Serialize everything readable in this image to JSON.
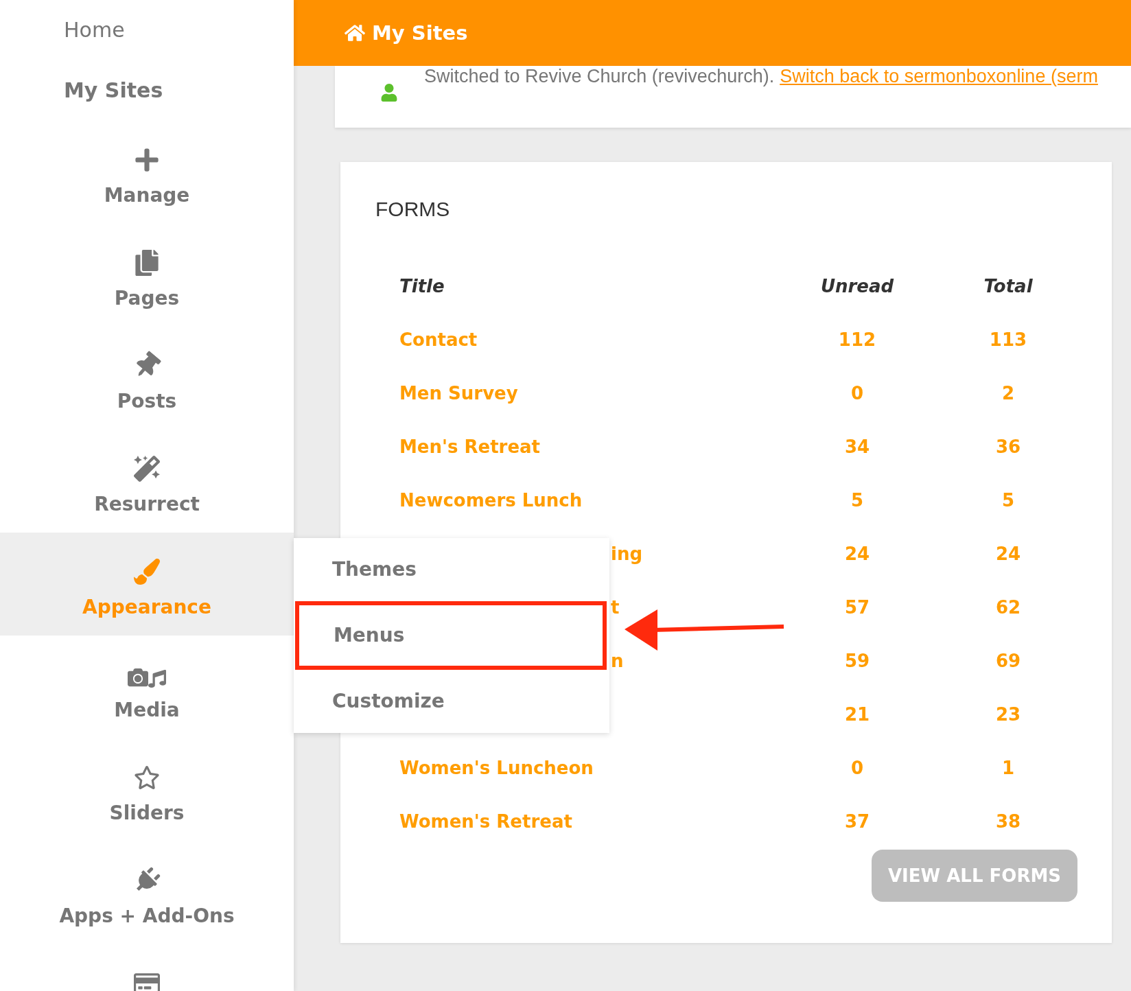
{
  "sidebar": {
    "top_links": [
      {
        "label": "Home",
        "bold": false
      },
      {
        "label": "My Sites",
        "bold": true
      }
    ],
    "items": [
      {
        "kind": "plus",
        "label": "Manage",
        "selected": false
      },
      {
        "kind": "pages",
        "label": "Pages",
        "selected": false
      },
      {
        "kind": "pin",
        "label": "Posts",
        "selected": false
      },
      {
        "kind": "wand",
        "label": "Resurrect",
        "selected": false
      },
      {
        "kind": "brush",
        "label": "Appearance",
        "selected": true
      },
      {
        "kind": "media",
        "label": "Media",
        "selected": false
      },
      {
        "kind": "star",
        "label": "Sliders",
        "selected": false
      },
      {
        "kind": "plug",
        "label": "Apps + Add-Ons",
        "selected": false
      },
      {
        "kind": "card",
        "selected": false
      }
    ]
  },
  "header": {
    "title": "My Sites"
  },
  "notice": {
    "text": "Switched to Revive Church (revivechurch).",
    "link": "Switch back to sermonboxonline (serm"
  },
  "forms": {
    "title": "FORMS",
    "columns": [
      "Title",
      "Unread",
      "Total"
    ],
    "rows": [
      {
        "kind": "full",
        "title": "Contact",
        "unread": "112",
        "total": "113"
      },
      {
        "kind": "full",
        "title": "Men Survey",
        "unread": "0",
        "total": "2"
      },
      {
        "kind": "full",
        "title": "Men's Retreat",
        "unread": "34",
        "total": "36"
      },
      {
        "kind": "full",
        "title": "Newcomers Lunch",
        "unread": "5",
        "total": "5"
      },
      {
        "kind": "covered",
        "title": "ing",
        "unread": "24",
        "total": "24"
      },
      {
        "kind": "covered",
        "title": "t",
        "unread": "57",
        "total": "62"
      },
      {
        "kind": "covered",
        "title": "n",
        "unread": "59",
        "total": "69"
      },
      {
        "kind": "covered",
        "unread": "21",
        "total": "23"
      },
      {
        "kind": "full",
        "title": "Women's Luncheon",
        "unread": "0",
        "total": "1"
      },
      {
        "kind": "full",
        "title": "Women's Retreat",
        "unread": "37",
        "total": "38"
      }
    ],
    "button": "VIEW ALL FORMS"
  },
  "popup_menu": {
    "items": [
      {
        "label": "Themes",
        "highlighted": false
      },
      {
        "label": "Menus",
        "highlighted": true
      },
      {
        "label": "Customize",
        "highlighted": false
      }
    ]
  }
}
